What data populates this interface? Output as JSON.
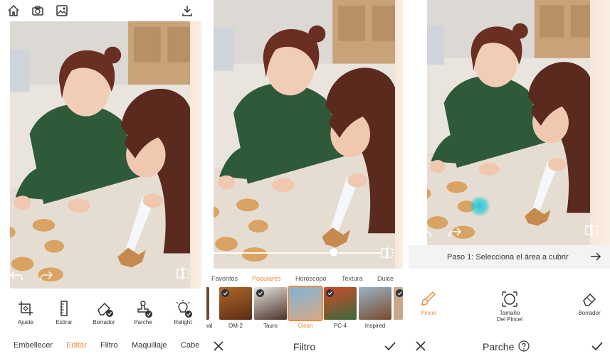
{
  "panel_editar": {
    "tools": [
      {
        "label": "Ajuste",
        "icon": "crop-icon"
      },
      {
        "label": "Estirar",
        "icon": "ruler-icon"
      },
      {
        "label": "Borrador",
        "icon": "eraser-icon"
      },
      {
        "label": "Parche",
        "icon": "stamp-icon"
      },
      {
        "label": "Relight",
        "icon": "bulb-icon"
      }
    ],
    "nav": [
      "Embellecer",
      "Editar",
      "Filtro",
      "Maquillaje",
      "Cabe"
    ],
    "nav_active": "Editar"
  },
  "panel_filtro": {
    "categories": [
      "Favoritos",
      "Populares",
      "Horóscopo",
      "Textura",
      "Dulce"
    ],
    "category_active": "Populares",
    "filters": [
      {
        "label": "nal"
      },
      {
        "label": "OM-2"
      },
      {
        "label": "Tauro"
      },
      {
        "label": "Clean"
      },
      {
        "label": "PC-4"
      },
      {
        "label": "Inspired"
      }
    ],
    "filter_selected": "Clean",
    "slider_value": 0.72,
    "title": "Filtro"
  },
  "panel_parche": {
    "step_text": "Paso 1: Selecciona el área a cubrir",
    "tools": [
      {
        "label": "Pincel"
      },
      {
        "label": "Tamaño\nDel Pincel"
      },
      {
        "label": "Borrador"
      }
    ],
    "tool_active": "Pincel",
    "title": "Parche"
  },
  "colors": {
    "accent": "#f08a3c",
    "brush": "#1ec8dc",
    "sweater": "#2f5a3a"
  }
}
